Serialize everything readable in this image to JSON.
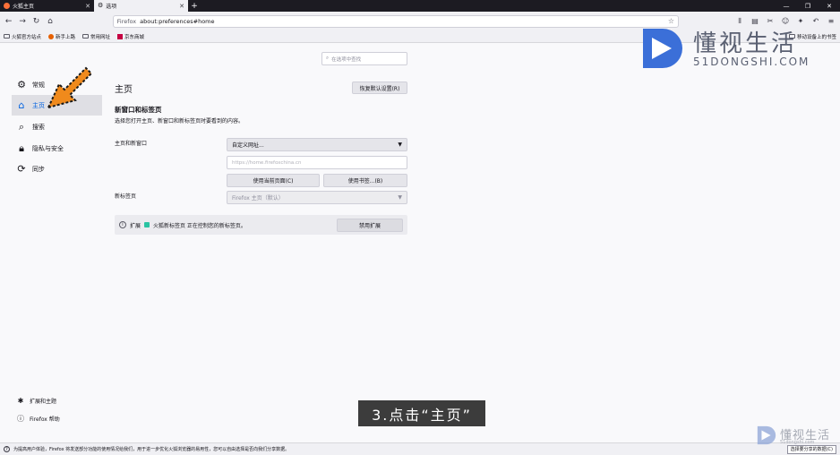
{
  "tabs": [
    {
      "title": "火狐主页",
      "active": false
    },
    {
      "title": "选项",
      "active": true
    }
  ],
  "urlbar": {
    "identity": "Firefox",
    "url": "about:preferences#home"
  },
  "bookmarks": {
    "items": [
      "火狐官方站点",
      "新手上路",
      "常用网址",
      "京东商城"
    ],
    "other": "移动设备上的书签"
  },
  "search": {
    "placeholder": "在选项中查找"
  },
  "sidebar": {
    "items": [
      {
        "label": "常规",
        "icon": "gear-icon"
      },
      {
        "label": "主页",
        "icon": "home-icon",
        "active": true
      },
      {
        "label": "搜索",
        "icon": "search-icon"
      },
      {
        "label": "隐私与安全",
        "icon": "lock-icon"
      },
      {
        "label": "同步",
        "icon": "sync-icon"
      }
    ],
    "bottom": [
      {
        "label": "扩展和主题",
        "icon": "puzzle-icon"
      },
      {
        "label": "Firefox 帮助",
        "icon": "help-icon"
      }
    ]
  },
  "main": {
    "title": "主页",
    "restore_label": "恢复默认设置(R)",
    "section_title": "新窗口和标签页",
    "section_desc": "选择您打开主页、新窗口和新标签页时要看到的内容。",
    "homepage_label": "主页和新窗口",
    "homepage_select": "自定义网址...",
    "homepage_url": "https://home.firefoxchina.cn",
    "use_current_label": "使用当前页面(C)",
    "use_bookmark_label": "使用书签...(B)",
    "newtab_label": "新标签页",
    "newtab_select": "Firefox 主页（默认）",
    "notice_prefix": "扩展",
    "notice_text": "火狐新标签页 正在控制您的新标签页。",
    "disable_ext_label": "禁用扩展"
  },
  "statusbar": {
    "message": "为提高用户体验，Firefox 将发送部分功能的使用情况给我们，用于进一步优化火狐浏览器的易用性，您可以自由选择是否向我们分享数据。",
    "choose_label": "选择要分享的数据(C)"
  },
  "overlay": {
    "caption": "3.点击“主页”"
  },
  "watermark": {
    "name": "懂视生活",
    "domain": "51DONGSHI.COM",
    "domain_small": "51dongshi.com"
  },
  "colors": {
    "accent": "#0061e0",
    "arrow": "#f08a1c",
    "watermark_blue": "#3b6fd8"
  }
}
